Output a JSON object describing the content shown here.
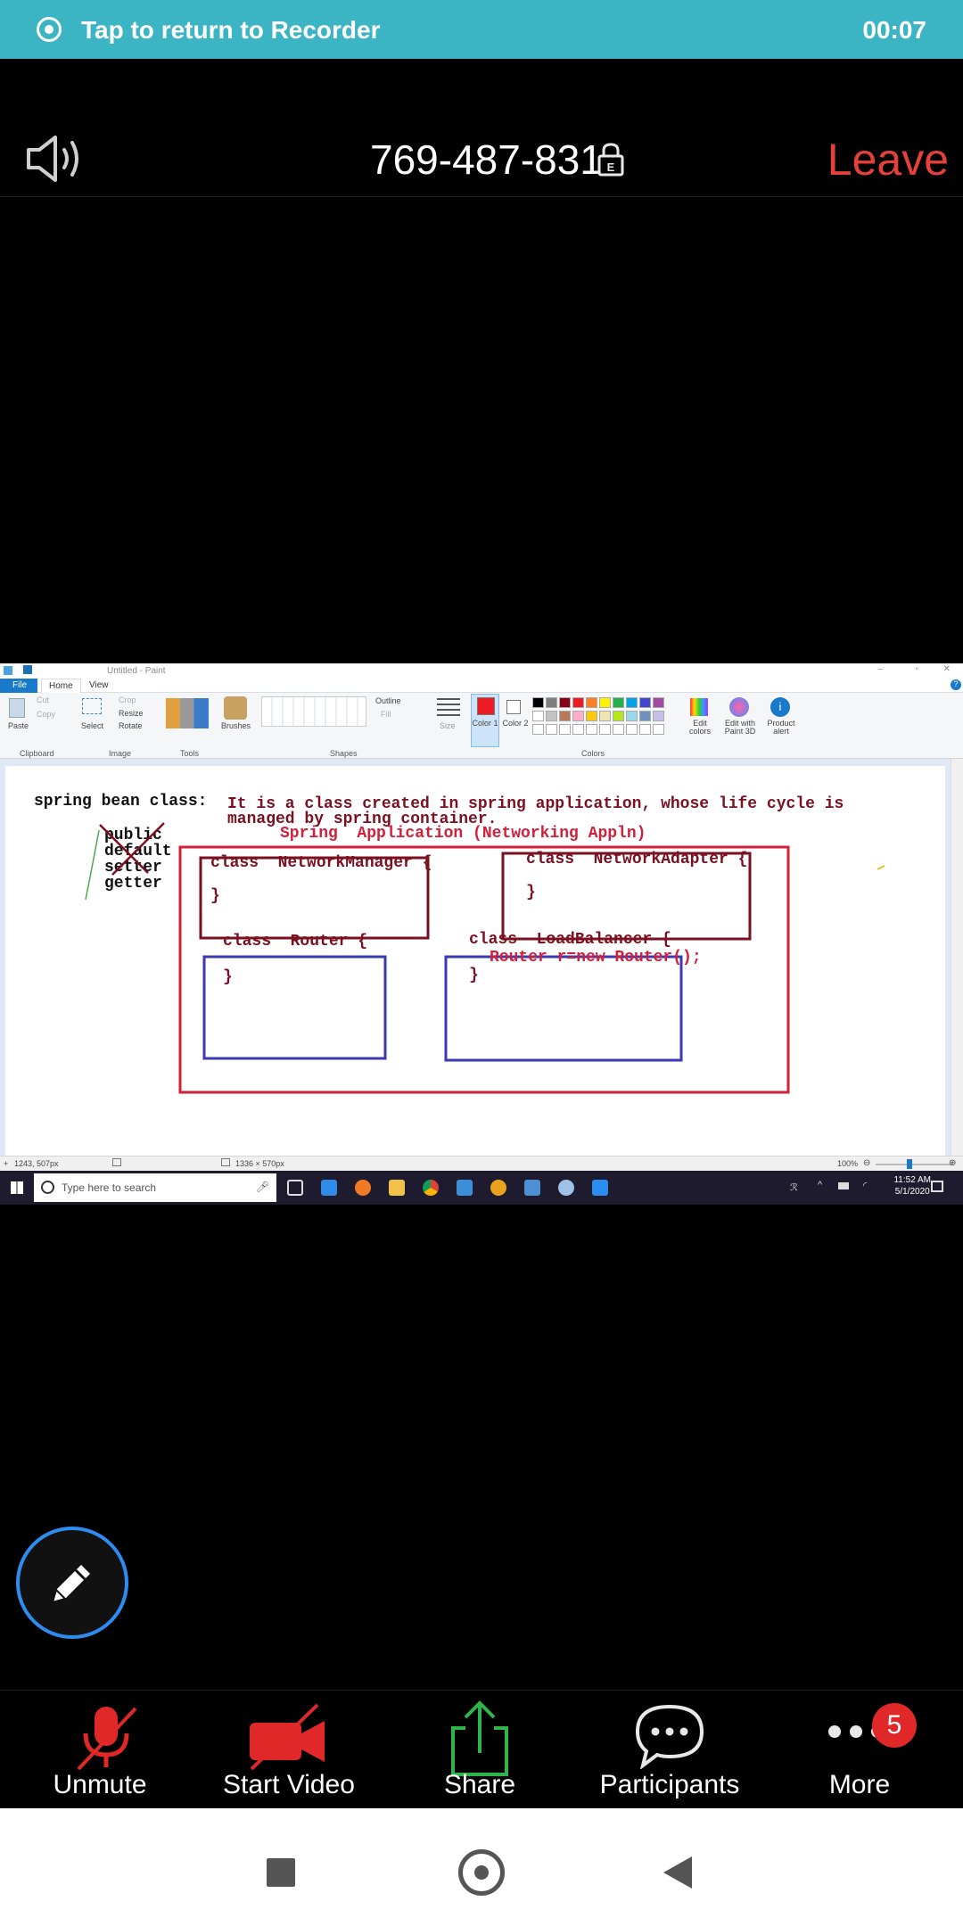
{
  "recorder_banner": {
    "text": "Tap to return to Recorder",
    "timer": "00:07"
  },
  "header": {
    "meeting_id": "769-487-831",
    "leave_label": "Leave",
    "lock_letter": "E",
    "speaker_icon": "speaker-icon"
  },
  "shared_screen": {
    "window_title": "Untitled - Paint",
    "tabs": [
      "File",
      "Home",
      "View"
    ],
    "ribbon": {
      "clipboard": {
        "paste": "Paste",
        "cut": "Cut",
        "copy": "Copy",
        "group": "Clipboard"
      },
      "image": {
        "crop": "Crop",
        "resize": "Resize",
        "rotate": "Rotate",
        "select": "Select",
        "group": "Image"
      },
      "tools": {
        "group": "Tools"
      },
      "brushes": "Brushes",
      "shapes": {
        "outline": "Outline",
        "fill": "Fill",
        "group": "Shapes"
      },
      "size": "Size",
      "color1": "Color 1",
      "color2": "Color 2",
      "edit_colors": "Edit colors",
      "edit_paint3d": "Edit with Paint 3D",
      "product_alert": "Product alert",
      "colors_group": "Colors",
      "palette": [
        "#000000",
        "#7f7f7f",
        "#880015",
        "#ed1c24",
        "#ff7f27",
        "#fff200",
        "#22b14c",
        "#00a2e8",
        "#3f48cc",
        "#a349a4",
        "#ffffff",
        "#c3c3c3",
        "#b97a57",
        "#ffaec9",
        "#ffc90e",
        "#efe4b0",
        "#b5e61d",
        "#99d9ea",
        "#7092be",
        "#c8bfe7"
      ],
      "color1_value": "#ed1c24"
    },
    "canvas": {
      "heading": "spring bean class:",
      "description_line1": "It is a class created in spring application, whose life cycle is",
      "description_line2": "managed by spring container.",
      "app_title": "Spring  Application (Networking Appln)",
      "modifiers": [
        "public",
        "default",
        "setter",
        "getter"
      ],
      "classes": {
        "network_manager": {
          "decl": "class  NetworkManager {",
          "close": "}"
        },
        "network_adapter": {
          "decl": "class  NetworkAdapter {",
          "close": "}"
        },
        "router": {
          "decl": "class  Router {",
          "close": "}"
        },
        "load_balancer": {
          "decl": "class  LoadBalancer {",
          "body": "Router r=new Router();",
          "close": "}"
        }
      }
    },
    "status": {
      "cursor": "1243, 507px",
      "dimensions": "1336 × 570px",
      "zoom": "100%"
    },
    "taskbar": {
      "search_placeholder": "Type here to search",
      "time": "11:52 AM",
      "date": "5/1/2020"
    }
  },
  "toolbar": {
    "unmute": "Unmute",
    "start_video": "Start Video",
    "share": "Share",
    "participants": "Participants",
    "more": "More",
    "more_badge": "5"
  },
  "colors": {
    "banner": "#3bb5c3",
    "leave": "#e5413a",
    "muted": "#e02828",
    "share": "#2fb44a",
    "annotate_ring": "#2d8cf0"
  }
}
